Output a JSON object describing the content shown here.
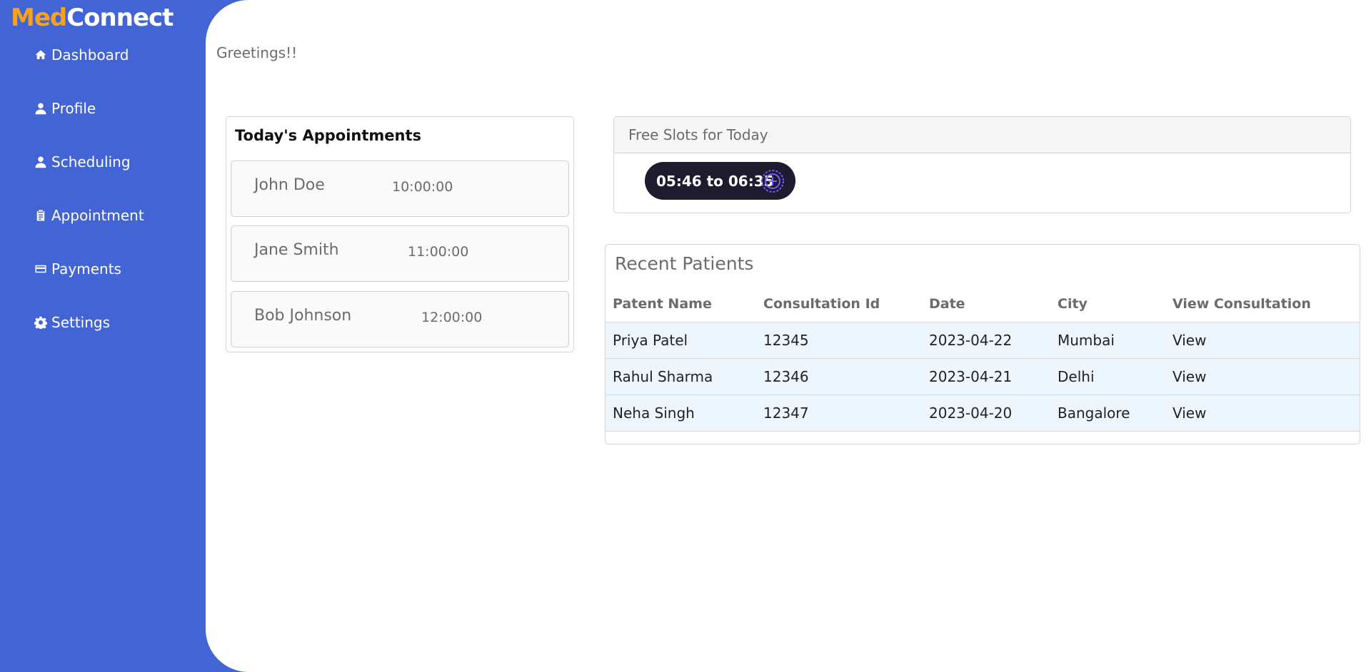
{
  "brand": {
    "part1": "Med",
    "part2": "Connect"
  },
  "sidebar": {
    "items": [
      {
        "label": "Dashboard",
        "icon": "home-icon"
      },
      {
        "label": "Profile",
        "icon": "user-icon"
      },
      {
        "label": "Scheduling",
        "icon": "user-icon"
      },
      {
        "label": "Appointment",
        "icon": "clipboard-icon"
      },
      {
        "label": "Payments",
        "icon": "credit-card-icon"
      },
      {
        "label": "Settings",
        "icon": "gear-icon"
      }
    ]
  },
  "greeting": "Greetings!!",
  "appointments": {
    "title": "Today's Appointments",
    "items": [
      {
        "name": "John Doe",
        "time": "10:00:00"
      },
      {
        "name": "Jane Smith",
        "time": "11:00:00"
      },
      {
        "name": "Bob Johnson",
        "time": "12:00:00"
      }
    ]
  },
  "slots": {
    "title": "Free Slots for Today",
    "items": [
      {
        "label": "05:46 to 06:35",
        "icon": "add-circle-icon"
      }
    ]
  },
  "recent_patients": {
    "title": "Recent Patients",
    "columns": [
      "Patent Name",
      "Consultation Id",
      "Date",
      "City",
      "View Consultation"
    ],
    "rows": [
      {
        "name": "Priya Patel",
        "id": "12345",
        "date": "2023-04-22",
        "city": "Mumbai",
        "view": "View"
      },
      {
        "name": "Rahul Sharma",
        "id": "12346",
        "date": "2023-04-21",
        "city": "Delhi",
        "view": "View"
      },
      {
        "name": "Neha Singh",
        "id": "12347",
        "date": "2023-04-20",
        "city": "Bangalore",
        "view": "View"
      }
    ]
  },
  "colors": {
    "sidebar_bg": "#4364d5",
    "brand_accent": "#f7a21b",
    "slot_pill_bg": "#1c1c2e",
    "slot_icon": "#7b5cff",
    "row_highlight": "#eef6fd"
  }
}
